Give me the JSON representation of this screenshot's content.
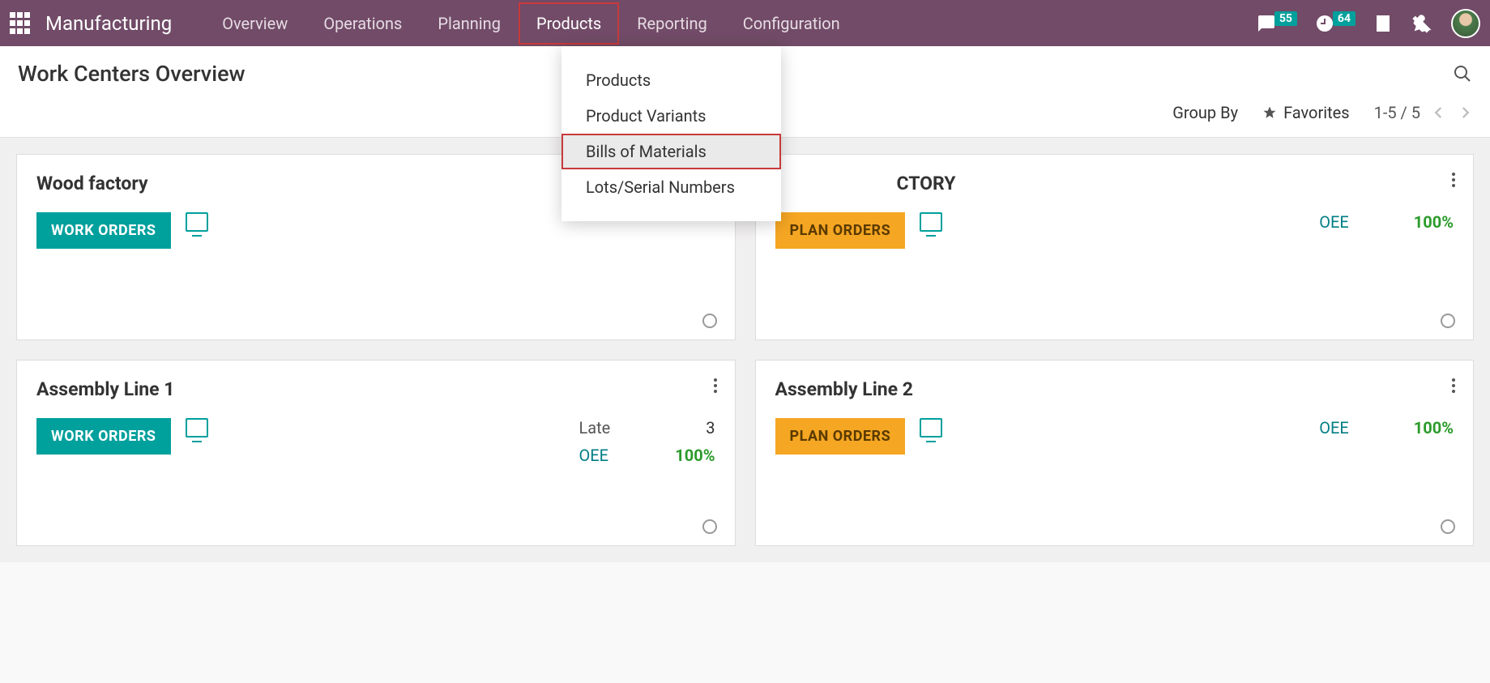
{
  "header": {
    "app_name": "Manufacturing",
    "menu": [
      "Overview",
      "Operations",
      "Planning",
      "Products",
      "Reporting",
      "Configuration"
    ],
    "active_menu_index": 3,
    "badges": {
      "messages": "55",
      "activities": "64"
    }
  },
  "dropdown": {
    "items": [
      "Products",
      "Product Variants",
      "Bills of Materials",
      "Lots/Serial Numbers"
    ],
    "highlight_index": 2
  },
  "page": {
    "title": "Work Centers Overview",
    "groupby_label": "Group By",
    "favorites_label": "Favorites",
    "pager_text": "1-5 / 5"
  },
  "cards": [
    {
      "title": "Wood factory",
      "button_label": "WORK ORDERS",
      "button_style": "teal",
      "show_menu": false,
      "stats": []
    },
    {
      "title": "WOOD FACTORY",
      "title_obscured": "CTORY",
      "button_label": "PLAN ORDERS",
      "button_style": "orange",
      "show_menu": true,
      "stats": [
        {
          "label": "OEE",
          "value": "100%",
          "green": true
        }
      ]
    },
    {
      "title": "Assembly Line 1",
      "button_label": "WORK ORDERS",
      "button_style": "teal",
      "show_menu": true,
      "stats": [
        {
          "label": "Late",
          "value": "3",
          "green": false,
          "late": true
        },
        {
          "label": "OEE",
          "value": "100%",
          "green": true
        }
      ]
    },
    {
      "title": "Assembly Line 2",
      "button_label": "PLAN ORDERS",
      "button_style": "orange",
      "show_menu": true,
      "stats": [
        {
          "label": "OEE",
          "value": "100%",
          "green": true
        }
      ]
    }
  ]
}
